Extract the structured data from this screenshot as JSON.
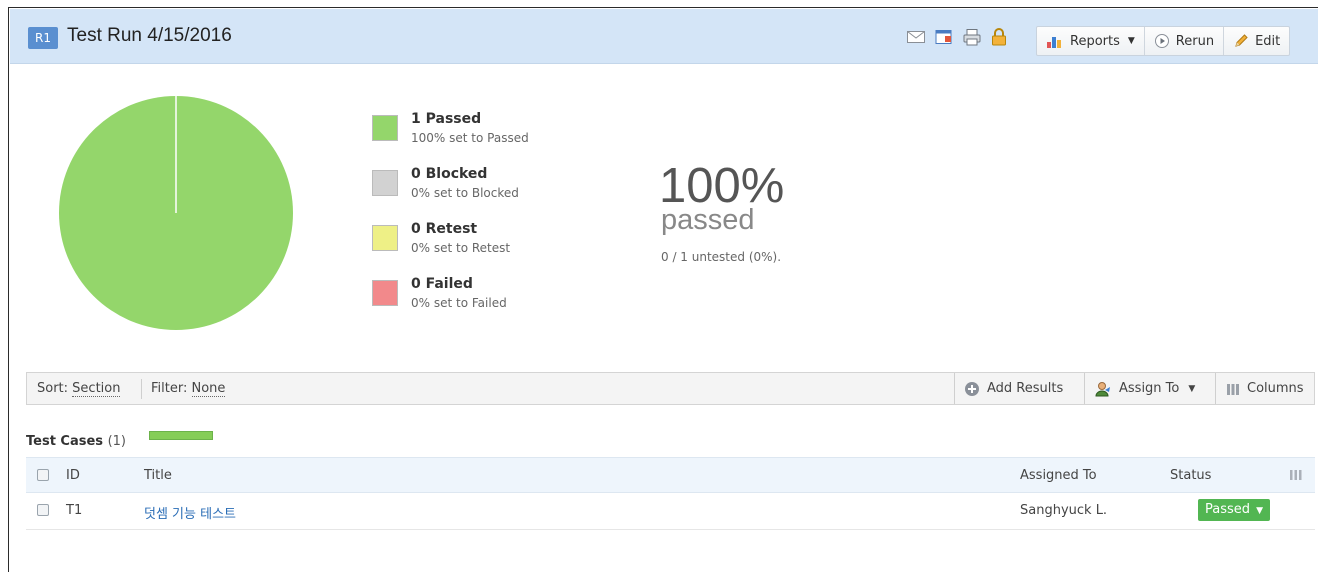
{
  "header": {
    "badge": "R1",
    "title": "Test Run 4/15/2016",
    "reports_label": "Reports",
    "rerun_label": "Rerun",
    "edit_label": "Edit"
  },
  "summary": {
    "legend": [
      {
        "title": "1 Passed",
        "subtitle": "100% set to Passed",
        "color": "#94d66b"
      },
      {
        "title": "0 Blocked",
        "subtitle": "0% set to Blocked",
        "color": "#d2d2d2"
      },
      {
        "title": "0 Retest",
        "subtitle": "0% set to Retest",
        "color": "#eef086"
      },
      {
        "title": "0 Failed",
        "subtitle": "0% set to Failed",
        "color": "#f2898b"
      }
    ],
    "percent": "100%",
    "percent_label": "passed",
    "untested": "0 / 1 untested (0%)."
  },
  "chart_data": {
    "type": "pie",
    "categories": [
      "Passed",
      "Blocked",
      "Retest",
      "Failed"
    ],
    "values": [
      1,
      0,
      0,
      0
    ],
    "colors": [
      "#94d66b",
      "#d2d2d2",
      "#eef086",
      "#f2898b"
    ]
  },
  "toolbar": {
    "sort_prefix": "Sort:",
    "sort_value": "Section",
    "filter_prefix": "Filter:",
    "filter_value": "None",
    "add_results": "Add Results",
    "assign_to": "Assign To",
    "columns": "Columns"
  },
  "test_cases": {
    "heading": "Test Cases",
    "count": "(1)",
    "progress": 1.0,
    "columns": {
      "id": "ID",
      "title": "Title",
      "assigned_to": "Assigned To",
      "status": "Status"
    },
    "rows": [
      {
        "id": "T1",
        "title": "덧셈 기능 테스트",
        "assigned_to": "Sanghyuck L.",
        "status": "Passed"
      }
    ]
  }
}
